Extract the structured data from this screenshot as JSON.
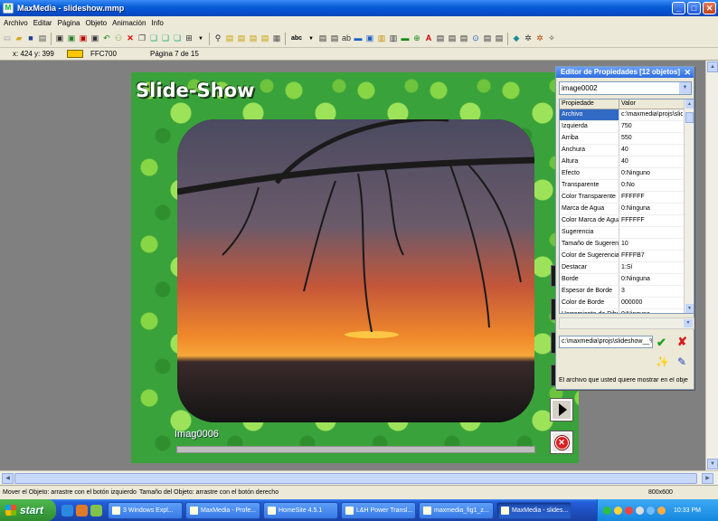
{
  "window": {
    "title": "MaxMedia - slideshow.mmp",
    "minimize": "_",
    "maximize": "□",
    "close": "✕"
  },
  "menu": [
    "Archivo",
    "Editar",
    "Página",
    "Objeto",
    "Animación",
    "Info"
  ],
  "toolbar": {
    "font_dropdown": "abc"
  },
  "coordbar": {
    "coords": "x: 424  y: 399",
    "color_hex": "FFC700",
    "color_swatch": "#FFC700",
    "page": "Página 7 de 15"
  },
  "slide": {
    "title": "Slide-Show",
    "caption": "Imag0006",
    "progress": 0.0
  },
  "props": {
    "title": "Editor de Propiedades [12 objetos]",
    "selected_object": "image0002",
    "col_property": "Propiedade",
    "col_value": "Valor",
    "rows": [
      {
        "name": "Archivo",
        "value": "c:\\maxmedia\\projs\\slide"
      },
      {
        "name": "Izquierda",
        "value": "750"
      },
      {
        "name": "Arriba",
        "value": "550"
      },
      {
        "name": "Anchura",
        "value": "40"
      },
      {
        "name": "Altura",
        "value": "40"
      },
      {
        "name": "Efecto",
        "value": "0:Ninguno"
      },
      {
        "name": "Transparente",
        "value": "0:No"
      },
      {
        "name": "Color Transparente",
        "value": "FFFFFF"
      },
      {
        "name": "Marca de Agua",
        "value": "0:Ninguna"
      },
      {
        "name": "Color Marca de Agua",
        "value": "FFFFFF"
      },
      {
        "name": "Sugerencia",
        "value": ""
      },
      {
        "name": "Tamaño de Sugerencia",
        "value": "10"
      },
      {
        "name": "Color de Sugerencia",
        "value": "FFFFB7"
      },
      {
        "name": "Destacar",
        "value": "1:Sí"
      },
      {
        "name": "Borde",
        "value": "0:Ninguna"
      },
      {
        "name": "Espesor de Borde",
        "value": "3"
      },
      {
        "name": "Color de Borde",
        "value": "000000"
      },
      {
        "name": "Herramienta de Dibujo",
        "value": "0:Ninguna"
      }
    ],
    "edit_value": "c:\\maxmedia\\projs\\slideshow__%",
    "hint": "El archivo que usted quiere mostrar en el obje"
  },
  "status": {
    "move": "Mover el Objeto: arrastre con el botón izquierdo",
    "size": "Tamaño del Objeto: arrastre con el botón derecho",
    "resolution": "800x600"
  },
  "taskbar": {
    "start": "start",
    "tasks": [
      "3 Windows Expl...",
      "MaxMedia - Profe...",
      "HomeSite 4.5.1",
      "L&H Power Transl...",
      "maxmedia_fig1_z...",
      "MaxMedia - slides..."
    ],
    "clock": "10:33 PM"
  }
}
